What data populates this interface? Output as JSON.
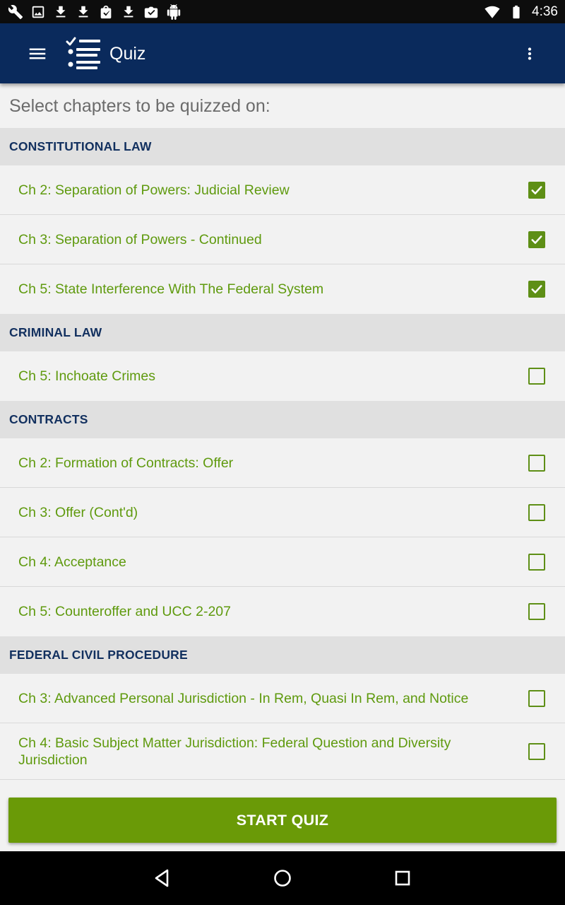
{
  "status_bar": {
    "time": "4:36",
    "left_icons": [
      "wrench-icon",
      "image-icon",
      "download-icon",
      "download-icon",
      "shopping-bag-icon",
      "download-icon",
      "photo-check-icon",
      "android-icon"
    ],
    "right_icons": [
      "wifi-icon",
      "battery-icon"
    ]
  },
  "app_bar": {
    "title": "Quiz",
    "color": "#0a2a5c"
  },
  "content": {
    "prompt": "Select chapters to be quizzed on:",
    "sections": [
      {
        "title": "CONSTITUTIONAL LAW",
        "chapters": [
          {
            "label": "Ch 2: Separation of Powers: Judicial Review",
            "checked": true
          },
          {
            "label": "Ch 3: Separation of Powers - Continued",
            "checked": true
          },
          {
            "label": "Ch 5: State Interference With The Federal System",
            "checked": true
          }
        ]
      },
      {
        "title": "CRIMINAL LAW",
        "chapters": [
          {
            "label": "Ch 5: Inchoate Crimes",
            "checked": false
          }
        ]
      },
      {
        "title": "CONTRACTS",
        "chapters": [
          {
            "label": "Ch 2: Formation of Contracts: Offer",
            "checked": false
          },
          {
            "label": "Ch 3: Offer (Cont'd)",
            "checked": false
          },
          {
            "label": "Ch 4: Acceptance",
            "checked": false
          },
          {
            "label": "Ch 5: Counteroffer and UCC 2-207",
            "checked": false
          }
        ]
      },
      {
        "title": "FEDERAL CIVIL PROCEDURE",
        "chapters": [
          {
            "label": "Ch 3: Advanced Personal Jurisdiction - In Rem, Quasi In Rem, and Notice",
            "checked": false
          },
          {
            "label": "Ch 4: Basic Subject Matter Jurisdiction: Federal Question and Diversity Jurisdiction",
            "checked": false
          }
        ]
      }
    ]
  },
  "start_button": {
    "label": "START QUIZ",
    "color": "#6a9a07"
  },
  "accent_color": "#5e8f16",
  "nav_bar": {
    "icons": [
      "back-icon",
      "home-icon",
      "recents-icon"
    ]
  }
}
